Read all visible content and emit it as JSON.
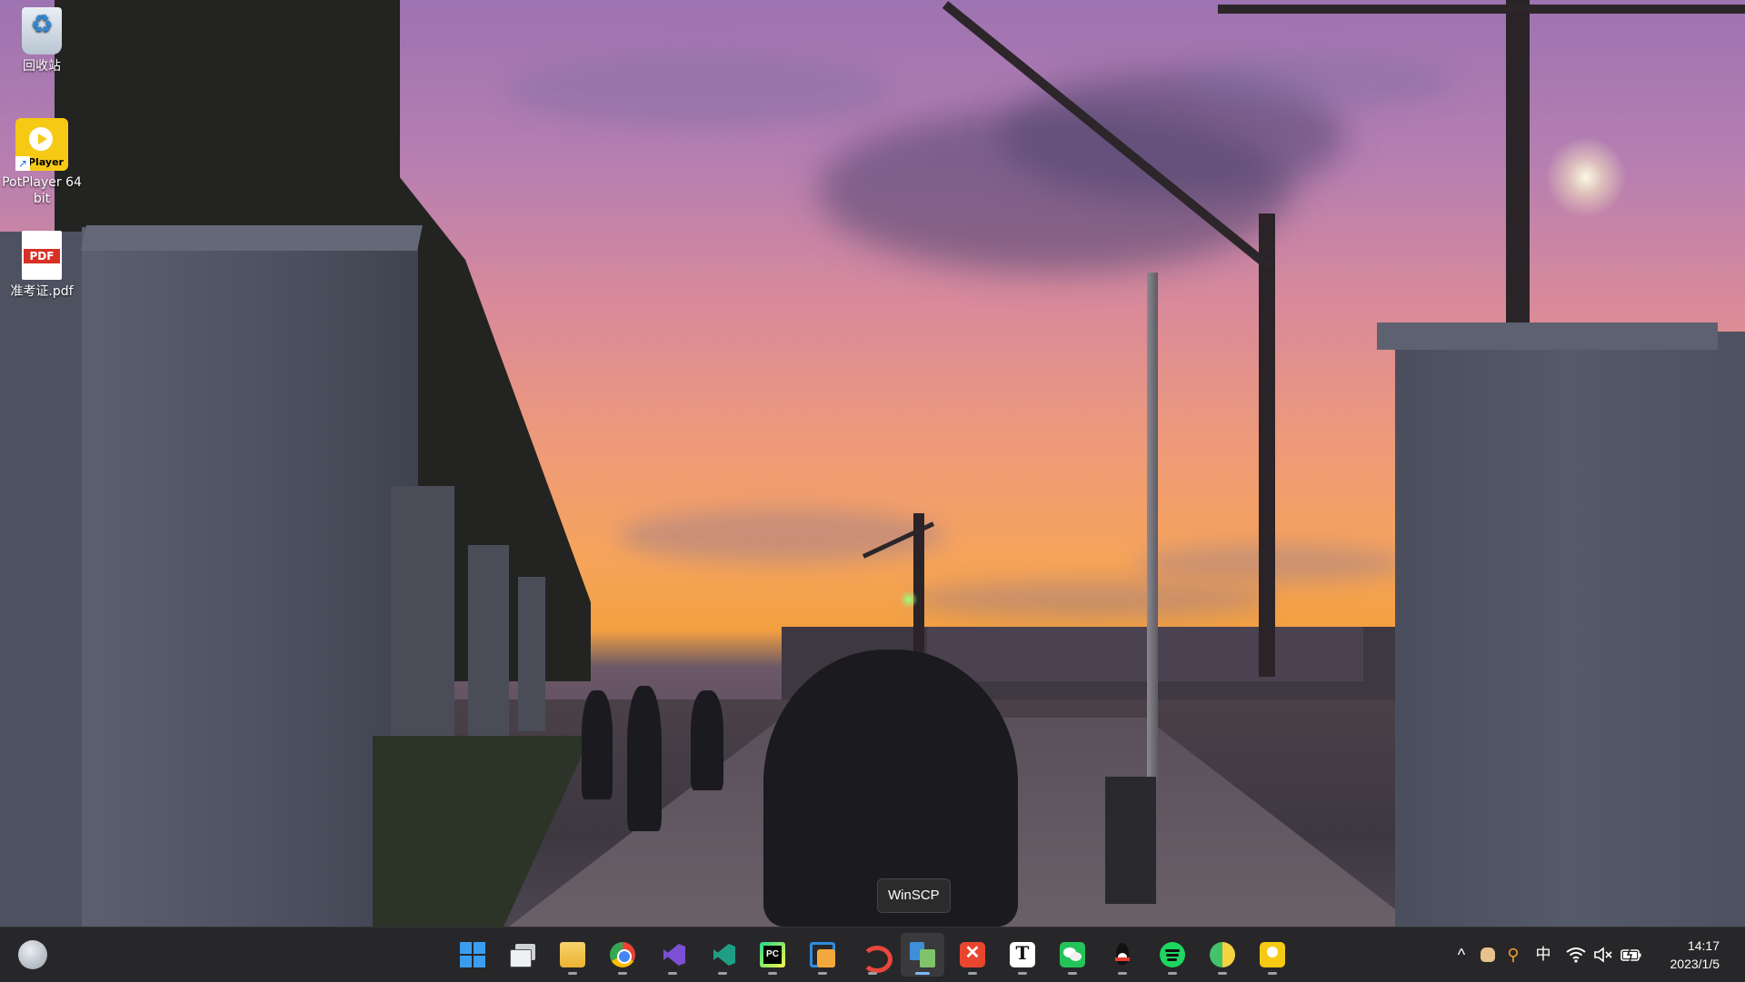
{
  "desktop": {
    "icons": [
      {
        "label": "回收站",
        "icon": "recycle-bin-icon"
      },
      {
        "label": "PotPlayer 64 bit",
        "icon": "potplayer-icon",
        "badge": "Player"
      },
      {
        "label": "准考证.pdf",
        "icon": "pdf-file-icon",
        "badge": "PDF"
      }
    ]
  },
  "tooltip": {
    "text": "WinSCP"
  },
  "taskbar": {
    "apps": [
      {
        "name": "Start",
        "icon": "windows-start-icon"
      },
      {
        "name": "Task View",
        "icon": "task-view-icon"
      },
      {
        "name": "File Explorer",
        "icon": "file-explorer-icon"
      },
      {
        "name": "Google Chrome",
        "icon": "chrome-icon"
      },
      {
        "name": "Visual Studio",
        "icon": "visual-studio-icon"
      },
      {
        "name": "Visual Studio Code",
        "icon": "vscode-icon"
      },
      {
        "name": "PyCharm",
        "icon": "pycharm-icon",
        "glyph": "PC"
      },
      {
        "name": "Remote Desktop",
        "icon": "remote-desktop-icon"
      },
      {
        "name": "Snail App",
        "icon": "snail-icon"
      },
      {
        "name": "WinSCP",
        "icon": "winscp-icon",
        "active": true
      },
      {
        "name": "XMind",
        "icon": "xmind-icon"
      },
      {
        "name": "Typora",
        "icon": "typora-icon",
        "glyph": "T"
      },
      {
        "name": "WeChat",
        "icon": "wechat-icon"
      },
      {
        "name": "QQ",
        "icon": "qq-icon"
      },
      {
        "name": "Spotify",
        "icon": "spotify-icon"
      },
      {
        "name": "Music Player",
        "icon": "music-player-icon"
      },
      {
        "name": "PotPlayer",
        "icon": "potplayer-taskbar-icon"
      }
    ],
    "tray": {
      "overflow_icon": "chevron-up-icon",
      "ime_label": "中",
      "icons": [
        "cat-tray-icon",
        "search-tray-icon",
        "wifi-icon",
        "volume-muted-icon",
        "battery-charging-icon"
      ]
    },
    "clock": {
      "time": "14:17",
      "date": "2023/1/5"
    }
  },
  "colors": {
    "taskbar_bg": "#202022",
    "active_indicator": "#7ab7ff",
    "tooltip_bg": "#2b2b2b"
  }
}
